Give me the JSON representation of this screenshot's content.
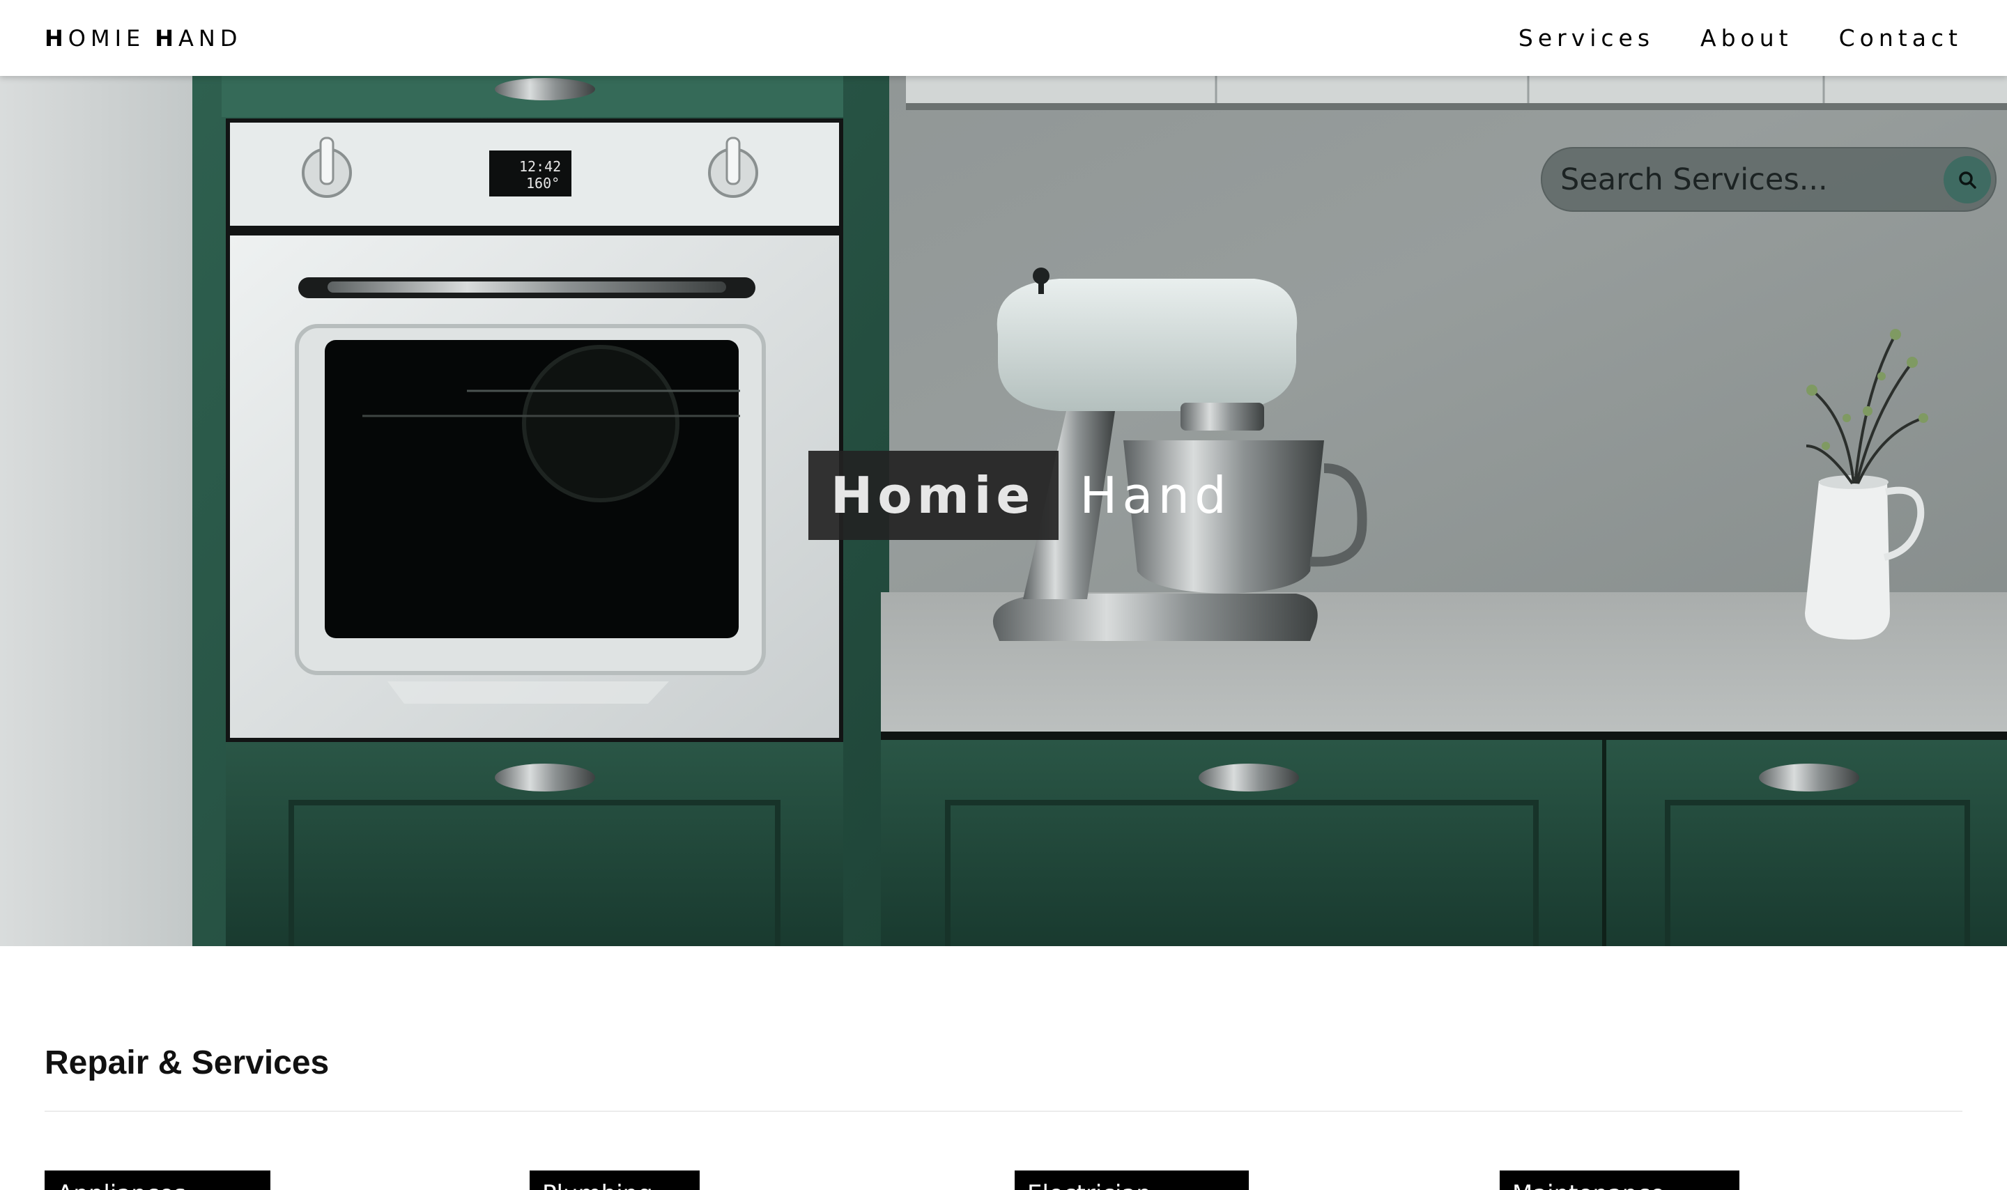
{
  "header": {
    "brand": {
      "first_initial": "H",
      "first_rest": "OMIE",
      "second_initial": "H",
      "second_rest": "AND"
    },
    "nav": [
      "Services",
      "About",
      "Contact"
    ]
  },
  "hero": {
    "title_bold": "Homie",
    "title_light": "Hand",
    "search": {
      "placeholder": "Search Services...",
      "icon": "search-icon"
    },
    "oven_display": [
      "12:42",
      "160°"
    ],
    "colors": {
      "cabinet_green": "#2c5a4a",
      "search_button": "#3f6b62",
      "backsplash": "#8f9593"
    }
  },
  "section": {
    "title": "Repair & Services",
    "cards": [
      {
        "label": "Appliances"
      },
      {
        "label": "Plumbing"
      },
      {
        "label": "Electrician"
      },
      {
        "label": "Maintenance"
      }
    ]
  }
}
